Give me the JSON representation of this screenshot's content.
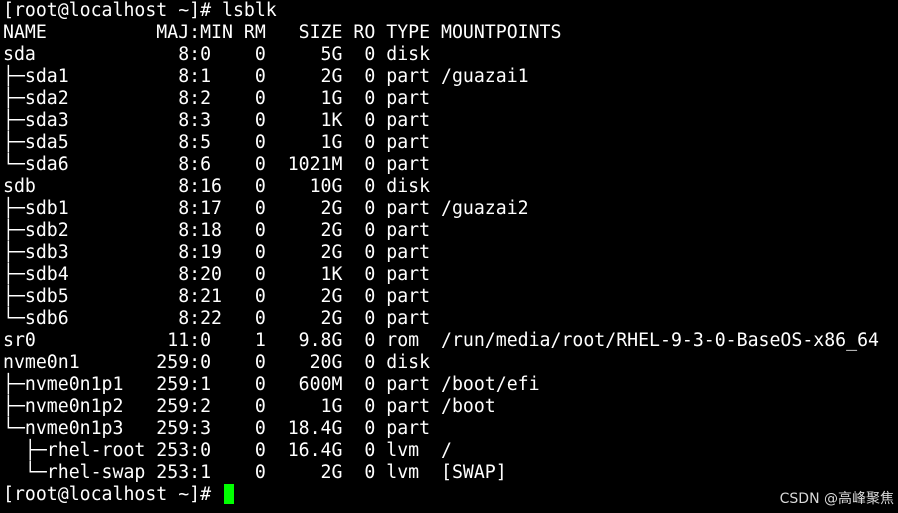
{
  "terminal": {
    "prompt_top": "[root@localhost ~]# lsblk",
    "header": "NAME          MAJ:MIN RM   SIZE RO TYPE MOUNTPOINTS",
    "rows": [
      "sda             8:0    0     5G  0 disk",
      "├─sda1          8:1    0     2G  0 part /guazai1",
      "├─sda2          8:2    0     1G  0 part",
      "├─sda3          8:3    0     1K  0 part",
      "├─sda5          8:5    0     1G  0 part",
      "└─sda6          8:6    0  1021M  0 part",
      "sdb             8:16   0    10G  0 disk",
      "├─sdb1          8:17   0     2G  0 part /guazai2",
      "├─sdb2          8:18   0     2G  0 part",
      "├─sdb3          8:19   0     2G  0 part",
      "├─sdb4          8:20   0     1K  0 part",
      "├─sdb5          8:21   0     2G  0 part",
      "└─sdb6          8:22   0     2G  0 part",
      "sr0            11:0    1   9.8G  0 rom  /run/media/root/RHEL-9-3-0-BaseOS-x86_64",
      "nvme0n1       259:0    0    20G  0 disk",
      "├─nvme0n1p1   259:1    0   600M  0 part /boot/efi",
      "├─nvme0n1p2   259:2    0     1G  0 part /boot",
      "└─nvme0n1p3   259:3    0  18.4G  0 part",
      "  ├─rhel-root 253:0    0  16.4G  0 lvm  /",
      "  └─rhel-swap 253:1    0     2G  0 lvm  [SWAP]"
    ],
    "prompt_bottom": "[root@localhost ~]# ",
    "cursor_color": "#00ff00"
  },
  "watermark": "CSDN @高峰聚焦"
}
